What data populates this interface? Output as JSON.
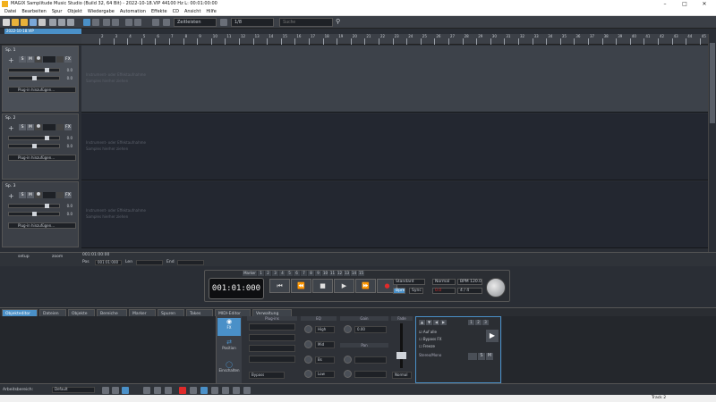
{
  "window": {
    "title": "MAGIX Samplitude Music Studio (Build 32, 64 Bit) - 2022-10-18.VIP 44100 Hz L: 00:01:00:00",
    "controls": [
      "–",
      "□",
      "✕"
    ]
  },
  "menu": [
    "Datei",
    "Bearbeiten",
    "Spur",
    "Objekt",
    "Wiedergabe",
    "Automation",
    "Effekte",
    "CD",
    "Ansicht",
    "Hilfe"
  ],
  "toolbar": {
    "snap_select": "Zeitleisten",
    "grid_select": "1/8",
    "search_placeholder": "Suche"
  },
  "timeline_label": "2022-10-18.VIP",
  "ruler_numbers": [
    "2",
    "3",
    "4",
    "5",
    "6",
    "7",
    "8",
    "9",
    "10",
    "11",
    "12",
    "13",
    "14",
    "15",
    "16",
    "17",
    "18",
    "19",
    "20",
    "21",
    "22",
    "23",
    "24",
    "25",
    "26",
    "27",
    "28",
    "29",
    "30",
    "31",
    "32",
    "33",
    "34",
    "35",
    "36",
    "37",
    "38",
    "39",
    "40",
    "41",
    "42",
    "43",
    "44",
    "45"
  ],
  "tracks": [
    {
      "name": "Sp. 1",
      "vol": "0.0",
      "pan": "0.0",
      "plugin": "Plug-in hinzufügen...",
      "hint1": "Instrument- oder Effektaufnahme",
      "hint2": "Samples hierher ziehen"
    },
    {
      "name": "Sp. 2",
      "vol": "0.0",
      "pan": "0.0",
      "plugin": "Plug-in hinzufügen...",
      "hint1": "Instrument- oder Effektaufnahme",
      "hint2": "Samples hierher ziehen"
    },
    {
      "name": "Sp. 3",
      "vol": "0.0",
      "pan": "0.0",
      "plugin": "Plug-in hinzufügen...",
      "hint1": "Instrument- oder Effektaufnahme",
      "hint2": "Samples hierher ziehen"
    }
  ],
  "track_buttons": {
    "solo": "S",
    "mute": "M",
    "fx": "FX"
  },
  "trackbar": {
    "setup": "setup",
    "zoom": "zoom",
    "pos_label": "Pos",
    "pos_value": "001:01:000",
    "len_label": "Len",
    "end_label": "End",
    "range_value": "001:01:00:00"
  },
  "transport": {
    "time": "001:01:000",
    "marker_label": "Marker",
    "markers": [
      "1",
      "2",
      "3",
      "4",
      "5",
      "6",
      "7",
      "8",
      "9",
      "10",
      "11",
      "12",
      "13",
      "14",
      "15"
    ],
    "buttons": [
      "⏮",
      "⏪",
      "■",
      "▶",
      "⏩",
      "●"
    ],
    "mode": "Standard",
    "loop_label": "Bpm",
    "punch_label": "Sync",
    "normal": "Normal",
    "bpm": "BPM 120.0",
    "signature": "4 / 4",
    "time_display": "0.0"
  },
  "bottom_tabs": [
    "Objekteditor",
    "Dateien",
    "Objekte",
    "Bereiche",
    "Marker",
    "Spuren",
    "Takes",
    "MIDI-Editor",
    "Verwaltung"
  ],
  "object_editor": {
    "side": [
      "FX",
      "Position",
      "Einschalten"
    ],
    "col_headers": [
      "Plug-ins",
      "EQ",
      "Gain",
      "Fade"
    ],
    "eq_labels": [
      "High",
      "Mid",
      "Bs",
      "Low"
    ],
    "gain_value": "0.00",
    "pan_label": "Pan",
    "normal_label": "Normal",
    "bypass_label": "Bypass",
    "checks": [
      "Auf alle",
      "Bypass FX",
      "Freeze"
    ],
    "stereo_label": "Stereo/Mono",
    "num_buttons": [
      "1",
      "2",
      "3"
    ]
  },
  "statusbar": {
    "workspace_label": "Arbeitsbereich:",
    "workspace_value": "Default"
  },
  "window_status": {
    "right": "Track 2"
  },
  "colors": {
    "accent": "#4a90c8",
    "record": "#e02a2a",
    "app_icon": "#f2b01e"
  }
}
